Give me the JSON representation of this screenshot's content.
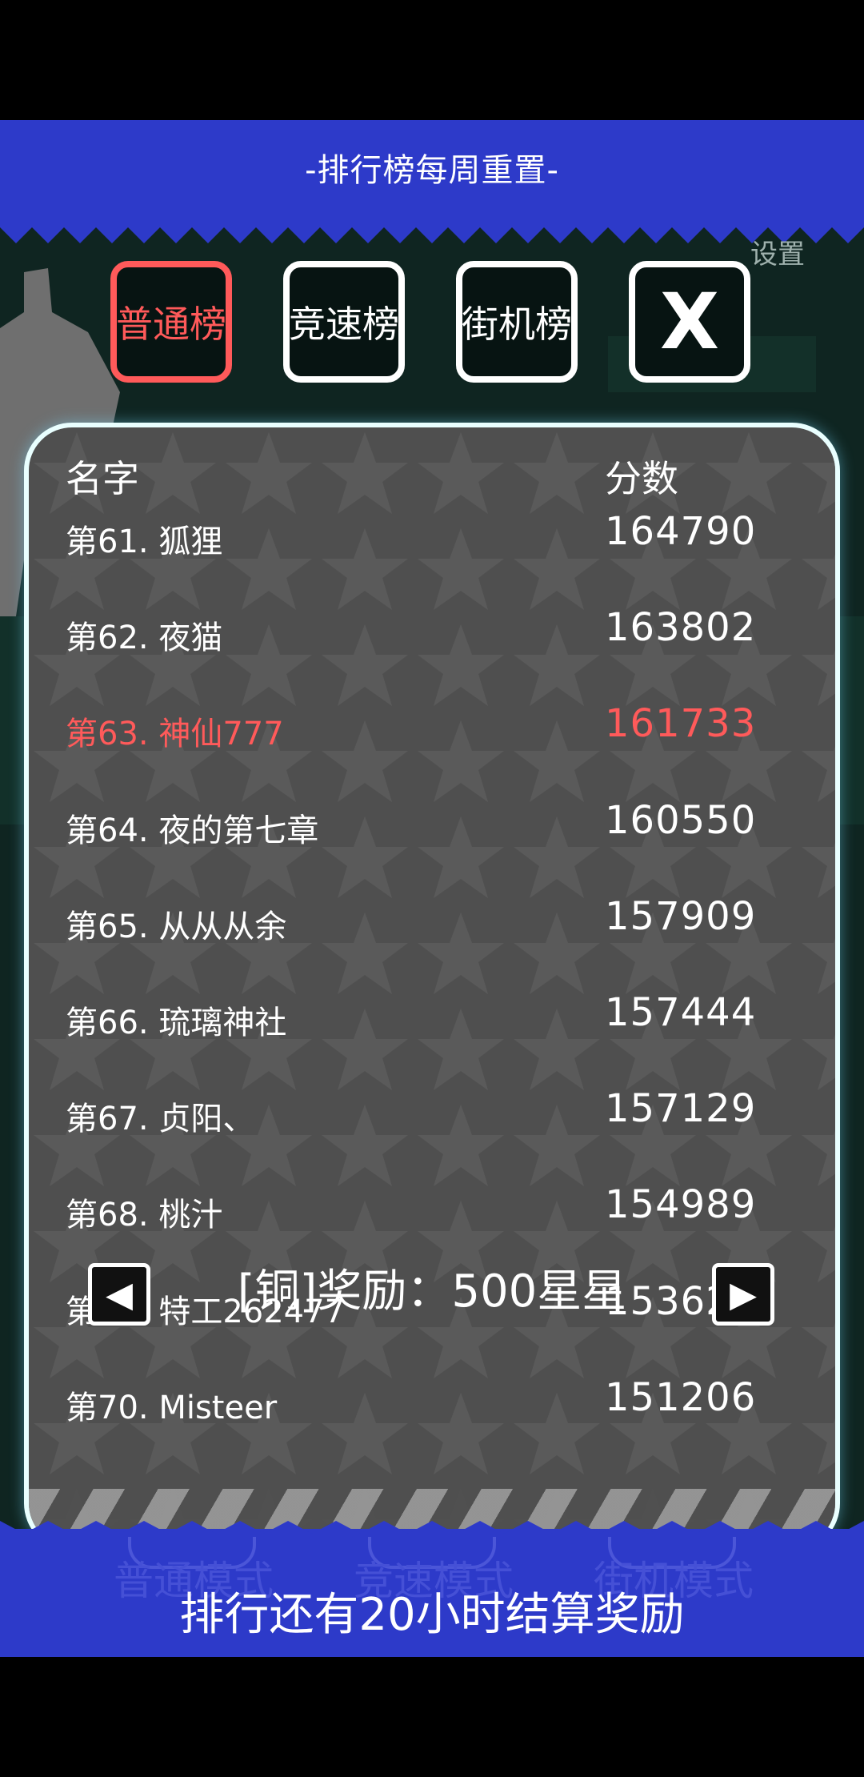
{
  "header": {
    "title": "-排行榜每周重置-"
  },
  "settings_label": "设置",
  "tabs": [
    {
      "label": "普通榜",
      "active": true
    },
    {
      "label": "竞速榜",
      "active": false
    },
    {
      "label": "街机榜",
      "active": false
    }
  ],
  "close_label": "X",
  "board": {
    "col_name": "名字",
    "col_score": "分数",
    "rows": [
      {
        "name": "第61. 狐狸",
        "score": "164790",
        "highlight": false
      },
      {
        "name": "第62. 夜猫",
        "score": "163802",
        "highlight": false
      },
      {
        "name": "第63. 神仙777",
        "score": "161733",
        "highlight": true
      },
      {
        "name": "第64. 夜的第七章",
        "score": "160550",
        "highlight": false
      },
      {
        "name": "第65. 从从从余",
        "score": "157909",
        "highlight": false
      },
      {
        "name": "第66. 琉璃神社",
        "score": "157444",
        "highlight": false
      },
      {
        "name": "第67. 贞阳、",
        "score": "157129",
        "highlight": false
      },
      {
        "name": "第68. 桃汁",
        "score": "154989",
        "highlight": false
      },
      {
        "name": "第69. 特工262477",
        "score": "153623",
        "highlight": false
      },
      {
        "name": "第70. Misteer",
        "score": "151206",
        "highlight": false
      }
    ]
  },
  "reward_text": "[铜]奖励：500星星",
  "prev_icon": "◀",
  "next_icon": "▶",
  "background_modes": [
    "普通模式",
    "竞速模式",
    "街机模式"
  ],
  "countdown": "排行还有20小时结算奖励",
  "colors": {
    "banner": "#2d3ac9",
    "highlight": "#ff5a5a",
    "board": "#4f4f4f"
  }
}
